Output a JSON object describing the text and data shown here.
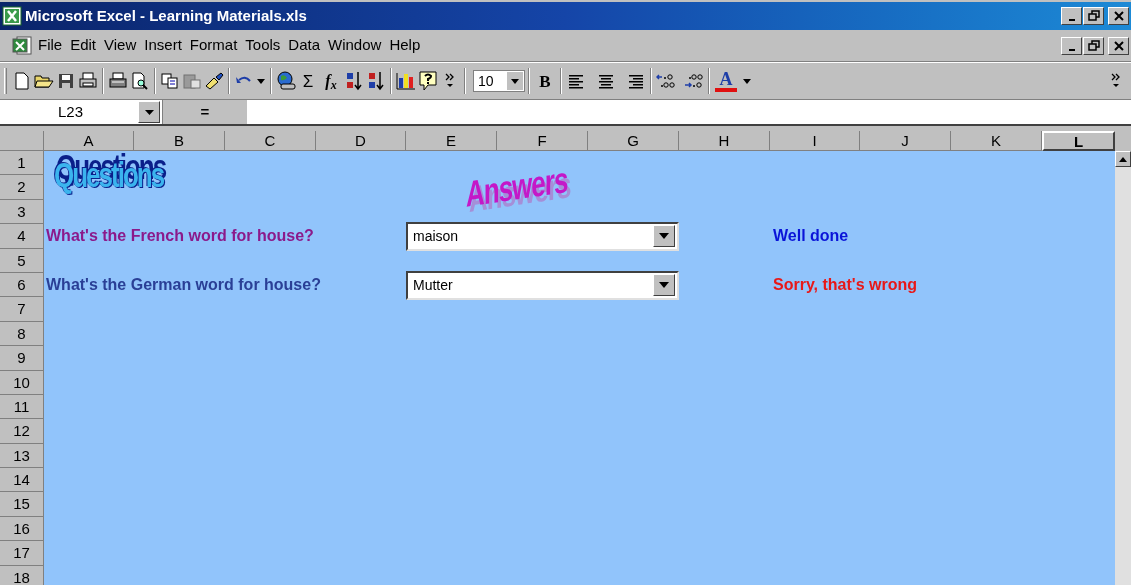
{
  "window": {
    "title": "Microsoft Excel - Learning Materials.xls"
  },
  "menu": [
    "File",
    "Edit",
    "View",
    "Insert",
    "Format",
    "Tools",
    "Data",
    "Window",
    "Help"
  ],
  "toolbar": {
    "sum_label": "Σ",
    "function_label": "f$_{x}$",
    "font_size": "10",
    "bold_label": "B",
    "font_color_label": "A"
  },
  "formula_bar": {
    "name_box": "L23",
    "equals": "="
  },
  "columns": [
    {
      "label": "A",
      "selected": false
    },
    {
      "label": "B",
      "selected": false
    },
    {
      "label": "C",
      "selected": false
    },
    {
      "label": "D",
      "selected": false
    },
    {
      "label": "E",
      "selected": false
    },
    {
      "label": "F",
      "selected": false
    },
    {
      "label": "G",
      "selected": false
    },
    {
      "label": "H",
      "selected": false
    },
    {
      "label": "I",
      "selected": false
    },
    {
      "label": "J",
      "selected": false
    },
    {
      "label": "K",
      "selected": false
    },
    {
      "label": "L",
      "selected": true
    }
  ],
  "rows": [
    "1",
    "2",
    "3",
    "4",
    "5",
    "6",
    "7",
    "8",
    "9",
    "10",
    "11",
    "12",
    "13",
    "14",
    "15",
    "16",
    "17",
    "18"
  ],
  "sheet": {
    "questions_title": "Questions",
    "answers_title": "Answers",
    "questions": [
      {
        "text": "What's the French word for house?",
        "color": "#8b1a8b",
        "answer": "maison",
        "feedback": "Well done",
        "kind": "correct"
      },
      {
        "text": "What's the German word for house?",
        "color": "#2a3f96",
        "answer": "Mutter",
        "feedback": "Sorry, that's wrong",
        "kind": "wrong"
      }
    ]
  }
}
